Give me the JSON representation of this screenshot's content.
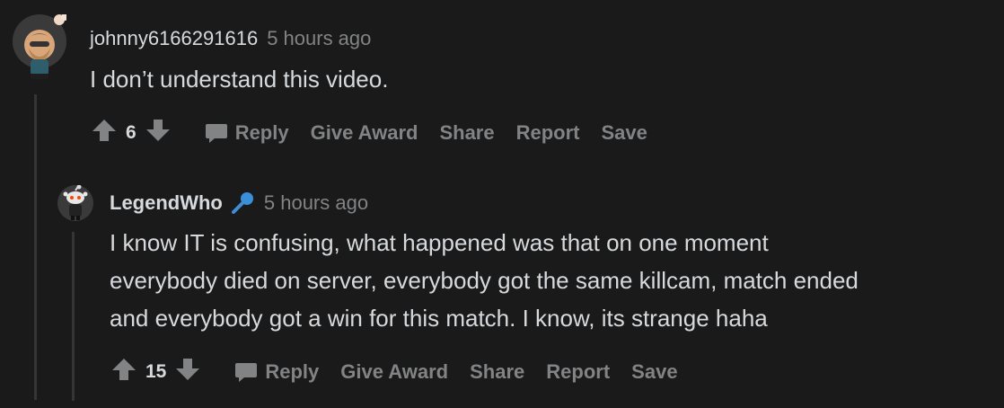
{
  "comments": [
    {
      "username": "johnny6166291616",
      "timestamp": "5 hours ago",
      "body": [
        "I don’t understand this video."
      ],
      "score": "6",
      "actions": {
        "reply": "Reply",
        "give_award": "Give Award",
        "share": "Share",
        "report": "Report",
        "save": "Save"
      },
      "avatar_icon": "snoo-avatar-icon"
    },
    {
      "username": "LegendWho",
      "timestamp": "5 hours ago",
      "flair_icon": "microphone-icon",
      "body": [
        "I know IT is confusing, what happened was that on one moment",
        "everybody died on server, everybody got the same killcam, match ended",
        "and everybody got a win for this match. I know, its strange haha"
      ],
      "score": "15",
      "actions": {
        "reply": "Reply",
        "give_award": "Give Award",
        "share": "Share",
        "report": "Report",
        "save": "Save"
      },
      "avatar_icon": "snoo-avatar-icon"
    }
  ],
  "colors": {
    "background": "#1a1a1b",
    "text": "#d7dadc",
    "muted": "#818384",
    "thread_line": "#343536",
    "flair_blue": "#3a8fd9"
  }
}
